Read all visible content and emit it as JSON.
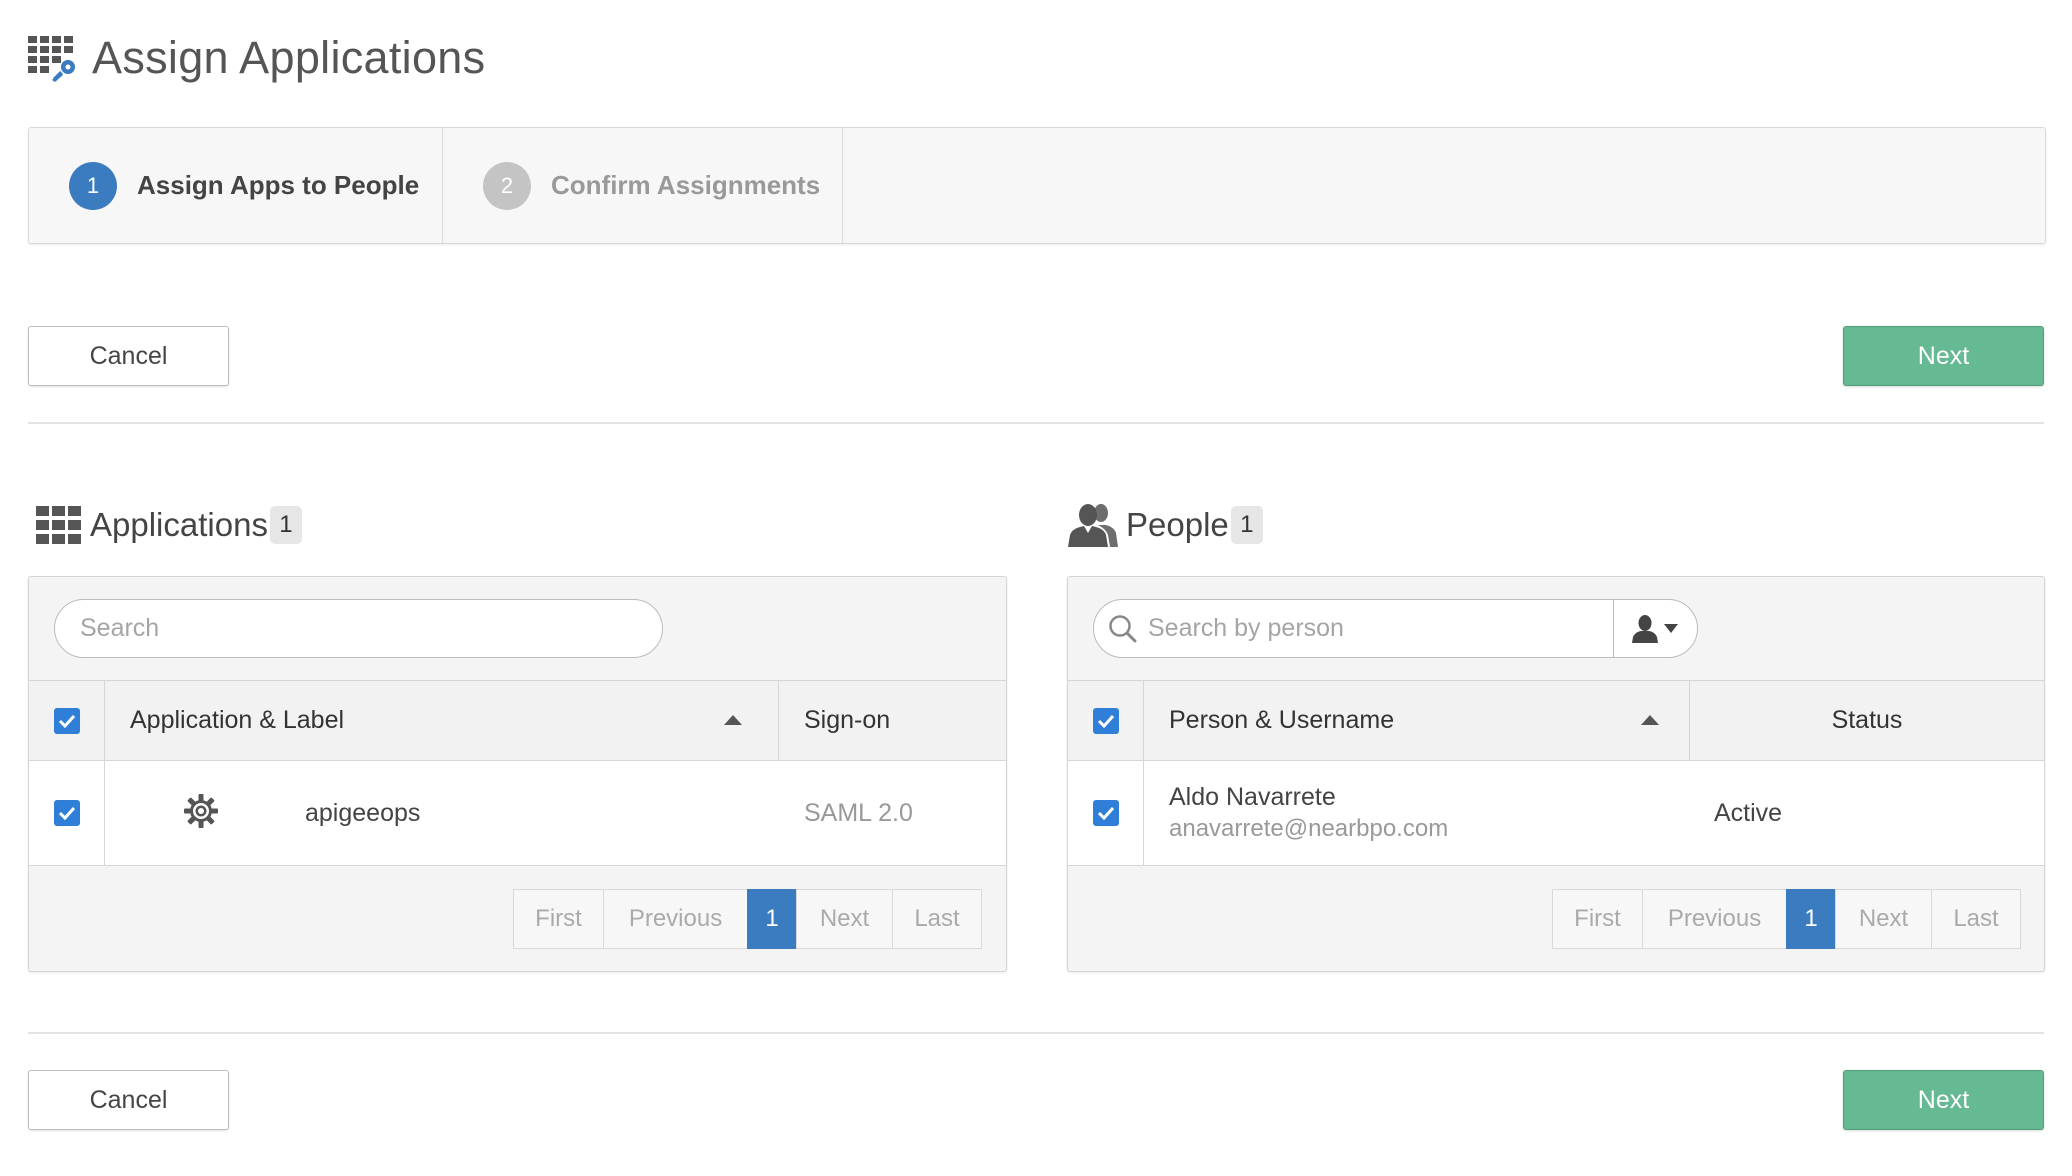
{
  "page": {
    "title": "Assign Applications"
  },
  "wizard": {
    "steps": [
      {
        "number": "1",
        "label": "Assign Apps to People",
        "state": "active"
      },
      {
        "number": "2",
        "label": "Confirm Assignments",
        "state": "inactive"
      }
    ]
  },
  "actions": {
    "cancel_label": "Cancel",
    "next_label": "Next"
  },
  "applications": {
    "title": "Applications",
    "count": "1",
    "search_placeholder": "Search",
    "columns": {
      "app": "Application & Label",
      "signon": "Sign-on"
    },
    "rows": [
      {
        "name": "apigeeops",
        "signon": "SAML 2.0",
        "icon": "gear-icon",
        "checked": true
      }
    ],
    "pager": {
      "first": "First",
      "previous": "Previous",
      "current": "1",
      "next": "Next",
      "last": "Last"
    }
  },
  "people": {
    "title": "People",
    "count": "1",
    "search_placeholder": "Search by person",
    "columns": {
      "person": "Person & Username",
      "status": "Status"
    },
    "rows": [
      {
        "name": "Aldo Navarrete",
        "username": "anavarrete@nearbpo.com",
        "status": "Active",
        "checked": true
      }
    ],
    "pager": {
      "first": "First",
      "previous": "Previous",
      "current": "1",
      "next": "Next",
      "last": "Last"
    }
  },
  "colors": {
    "primary": "#3b7bc0",
    "success": "#65b993",
    "checkbox": "#2f7fd8"
  }
}
